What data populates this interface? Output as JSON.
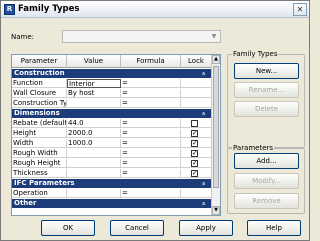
{
  "window": {
    "title": "Family Types",
    "close_glyph": "✕",
    "icon_glyph": "R"
  },
  "name_field": {
    "label": "Name:",
    "value": "",
    "arrow": "▼"
  },
  "grid": {
    "headers": [
      "Parameter",
      "Value",
      "Formula",
      "Lock"
    ],
    "groups": [
      {
        "label": "Construction",
        "rows": [
          {
            "param": "Function",
            "value": "Interior",
            "formula": "=",
            "lock": null
          },
          {
            "param": "Wall Closure",
            "value": "By host",
            "formula": "=",
            "lock": null
          },
          {
            "param": "Construction Ty",
            "value": "",
            "formula": "=",
            "lock": null
          }
        ]
      },
      {
        "label": "Dimensions",
        "rows": [
          {
            "param": "Rebate (default",
            "value": "44.0",
            "formula": "=",
            "lock": false
          },
          {
            "param": "Height",
            "value": "2000.0",
            "formula": "=",
            "lock": true
          },
          {
            "param": "Width",
            "value": "1000.0",
            "formula": "=",
            "lock": true
          },
          {
            "param": "Rough Width",
            "value": "",
            "formula": "=",
            "lock": true
          },
          {
            "param": "Rough Height",
            "value": "",
            "formula": "=",
            "lock": true
          },
          {
            "param": "Thickness",
            "value": "",
            "formula": "=",
            "lock": true
          }
        ]
      },
      {
        "label": "IFC Parameters",
        "rows": [
          {
            "param": "Operation",
            "value": "",
            "formula": "=",
            "lock": null
          }
        ]
      },
      {
        "label": "Other",
        "rows": []
      }
    ],
    "collapse_glyph": "»"
  },
  "family_types": {
    "legend": "Family Types",
    "new_label": "New...",
    "rename_label": "Rename...",
    "delete_label": "Delete"
  },
  "parameters": {
    "legend": "Parameters",
    "add_label": "Add...",
    "modify_label": "Modify...",
    "remove_label": "Remove"
  },
  "footer": {
    "ok_label": "OK",
    "cancel_label": "Cancel",
    "apply_label": "Apply",
    "help_label": "Help"
  }
}
